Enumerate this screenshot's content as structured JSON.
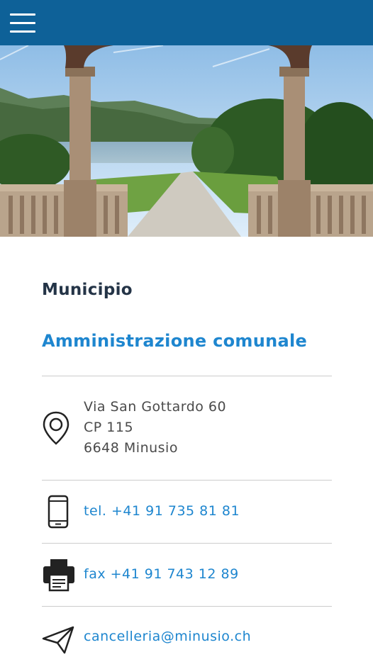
{
  "header": {
    "menu_icon": "hamburger-menu-icon",
    "background": "#0e6198"
  },
  "hero": {
    "image": "villa-garden-lake-arches-photo"
  },
  "contact": {
    "title": "Municipio",
    "subtitle": "Amministrazione comunale",
    "address": {
      "icon": "location-pin-icon",
      "line1": "Via San Gottardo 60",
      "line2": "CP 115",
      "line3": "6648 Minusio"
    },
    "phone": {
      "icon": "mobile-phone-icon",
      "label": "tel. +41 91 735 81 81"
    },
    "fax": {
      "icon": "printer-fax-icon",
      "label": "fax +41 91 743 12 89"
    },
    "email": {
      "icon": "paper-plane-icon",
      "label": "cancelleria@minusio.ch"
    }
  },
  "colors": {
    "accent": "#1e86cf",
    "title": "#243447",
    "text": "#4a4a4a",
    "divider": "#cccccc"
  }
}
